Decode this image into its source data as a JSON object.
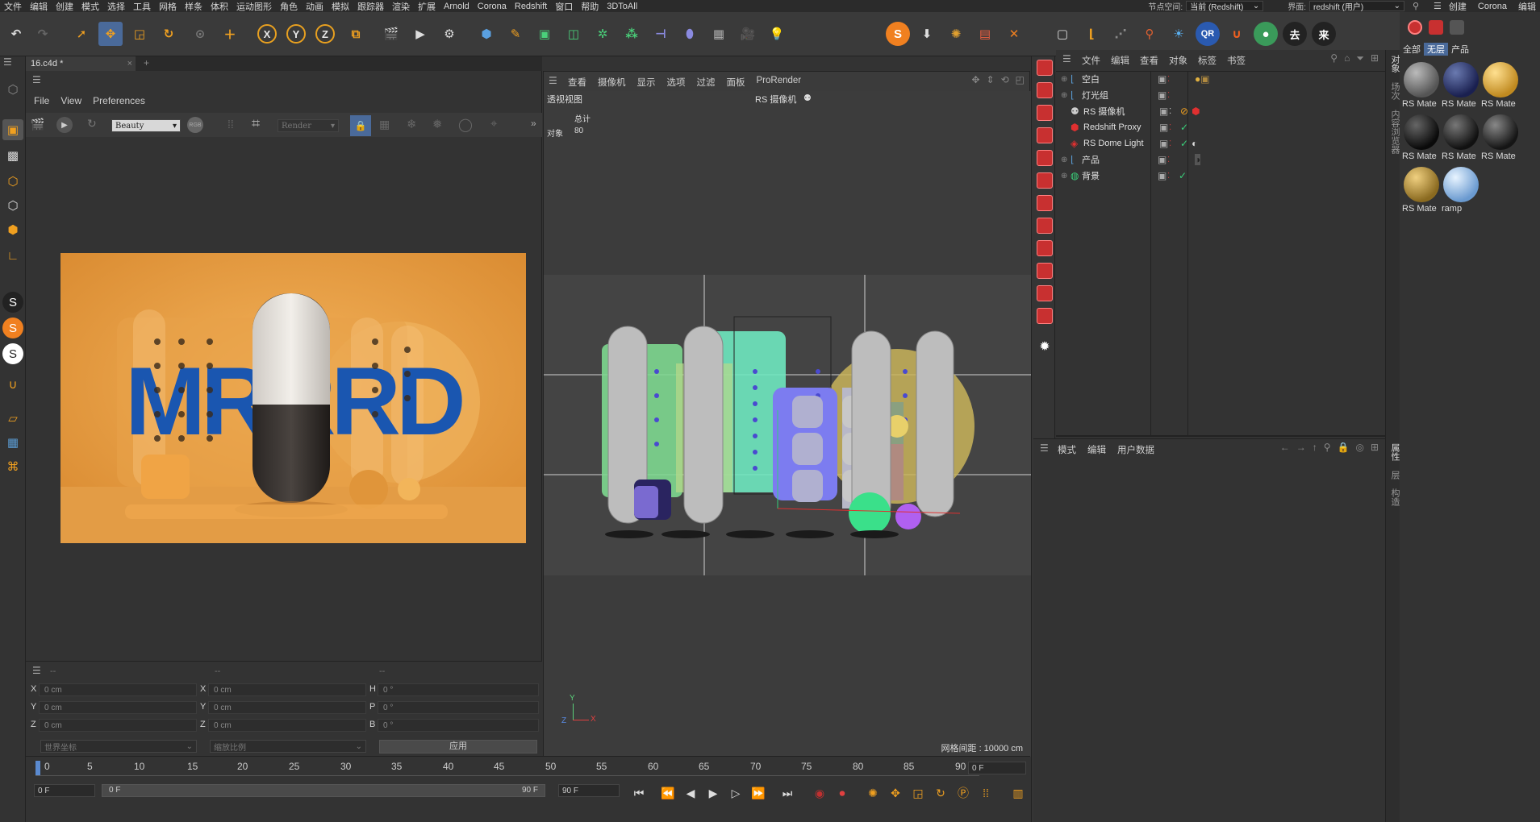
{
  "menu": [
    "文件",
    "编辑",
    "创建",
    "模式",
    "选择",
    "工具",
    "网格",
    "样条",
    "体积",
    "运动图形",
    "角色",
    "动画",
    "模拟",
    "跟踪器",
    "渲染",
    "扩展",
    "Arnold",
    "Corona",
    "Redshift",
    "窗口",
    "帮助",
    "3DToAll"
  ],
  "menu_right": {
    "node_space_label": "节点空间:",
    "node_space_value": "当前 (Redshift)",
    "layout_label": "界面:",
    "layout_value": "redshift (用户)"
  },
  "rightpanel_menu": [
    "创建",
    "Corona",
    "编辑"
  ],
  "toolbar": {
    "axis_x": "X",
    "axis_y": "Y",
    "axis_z": "Z"
  },
  "doc_tab": "16.c4d *",
  "pv": {
    "menu": [
      "File",
      "View",
      "Preferences"
    ],
    "aov": "Beauty",
    "render_label": "Render"
  },
  "render_image": {
    "text": "MRRRD",
    "bg": "#e9a04a"
  },
  "viewport": {
    "menu": [
      "查看",
      "摄像机",
      "显示",
      "选项",
      "过滤",
      "面板",
      "ProRender"
    ],
    "name": "透视视图",
    "camera": "RS 摄像机",
    "stats_header": "总计",
    "stats_label": "对象",
    "stats_value": "80",
    "grid_spacing": "网格间距 : 10000 cm",
    "axes": {
      "y": "Y",
      "x": "X",
      "z": "Z"
    }
  },
  "coords": {
    "headers": [
      "--",
      "--",
      "--"
    ],
    "rows": [
      {
        "a": "X",
        "av": "0 cm",
        "b": "X",
        "bv": "0 cm",
        "c": "H",
        "cv": "0 °"
      },
      {
        "a": "Y",
        "av": "0 cm",
        "b": "Y",
        "bv": "0 cm",
        "c": "P",
        "cv": "0 °"
      },
      {
        "a": "Z",
        "av": "0 cm",
        "b": "Z",
        "bv": "0 cm",
        "c": "B",
        "cv": "0 °"
      }
    ],
    "space": "世界坐标",
    "scale": "缩放比例",
    "apply": "应用"
  },
  "timeline": {
    "ticks": [
      "0",
      "5",
      "10",
      "15",
      "20",
      "25",
      "30",
      "35",
      "40",
      "45",
      "50",
      "55",
      "60",
      "65",
      "70",
      "75",
      "80",
      "85",
      "90"
    ],
    "current_frame": "0 F",
    "start_frame": "0 F",
    "range_start": "0 F",
    "range_end": "90 F",
    "end_frame": "90 F"
  },
  "objects": {
    "menu": [
      "文件",
      "编辑",
      "查看",
      "对象",
      "标签",
      "书签"
    ],
    "items": [
      {
        "name": "空白",
        "indent": 0
      },
      {
        "name": "灯光组",
        "indent": 0
      },
      {
        "name": "RS 摄像机",
        "indent": 1
      },
      {
        "name": "Redshift Proxy",
        "indent": 1
      },
      {
        "name": "RS Dome Light",
        "indent": 1
      },
      {
        "name": "产品",
        "indent": 0
      },
      {
        "name": "背景",
        "indent": 0
      }
    ]
  },
  "attributes": {
    "menu": [
      "模式",
      "编辑",
      "用户数据"
    ]
  },
  "side_tabs": {
    "top": [
      "对象",
      "场次",
      "内容浏览器"
    ],
    "bottom": [
      "属性",
      "层",
      "构造"
    ]
  },
  "materials": {
    "tabs": [
      "全部",
      "无层",
      "产品"
    ],
    "items": [
      {
        "label": "RS Mate",
        "color": "#7a7a7a"
      },
      {
        "label": "RS Mate",
        "color": "#3a4a7a"
      },
      {
        "label": "RS Mate",
        "color": "#e0b040"
      },
      {
        "label": "RS Mate",
        "color": "#222222"
      },
      {
        "label": "RS Mate",
        "color": "#2a2a2a"
      },
      {
        "label": "RS Mate",
        "color": "#333333"
      },
      {
        "label": "RS Mate",
        "color": "#c9a848"
      },
      {
        "label": "ramp",
        "color": "#a8c8f0"
      }
    ]
  }
}
